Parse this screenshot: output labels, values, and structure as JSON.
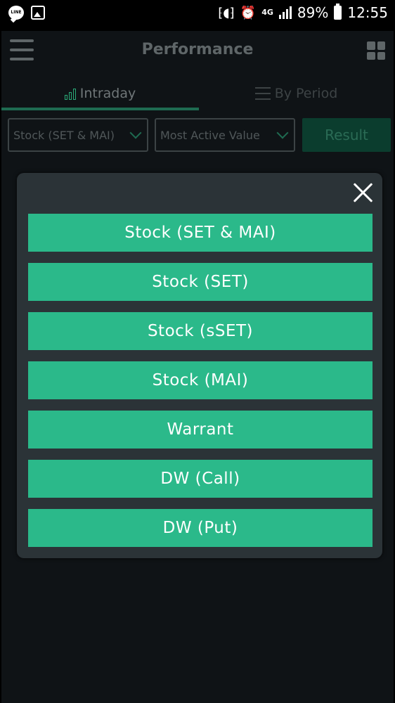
{
  "status_bar": {
    "network": "4G",
    "battery": "89%",
    "time": "12:55",
    "icons": [
      "line-app-icon",
      "image-icon",
      "vibrate-icon",
      "alarm-icon",
      "signal-icon",
      "battery-icon"
    ]
  },
  "header": {
    "title": "Performance",
    "menu_icon": "hamburger-icon",
    "grid_icon": "grid-icon"
  },
  "tabs": [
    {
      "label": "Intraday",
      "active": true,
      "icon": "bar-chart-icon"
    },
    {
      "label": "By Period",
      "active": false,
      "icon": "sliders-icon"
    }
  ],
  "filters": {
    "market": "Stock (SET & MAI)",
    "ranking": "Most Active Value",
    "result_label": "Result"
  },
  "modal": {
    "options": [
      "Stock (SET & MAI)",
      "Stock (SET)",
      "Stock (sSET)",
      "Stock (MAI)",
      "Warrant",
      "DW (Call)",
      "DW (Put)"
    ]
  },
  "colors": {
    "accent": "#2bb98a",
    "background": "#0f1316",
    "modal_bg": "#2b3337",
    "tab_underline": "#1e6b51"
  }
}
